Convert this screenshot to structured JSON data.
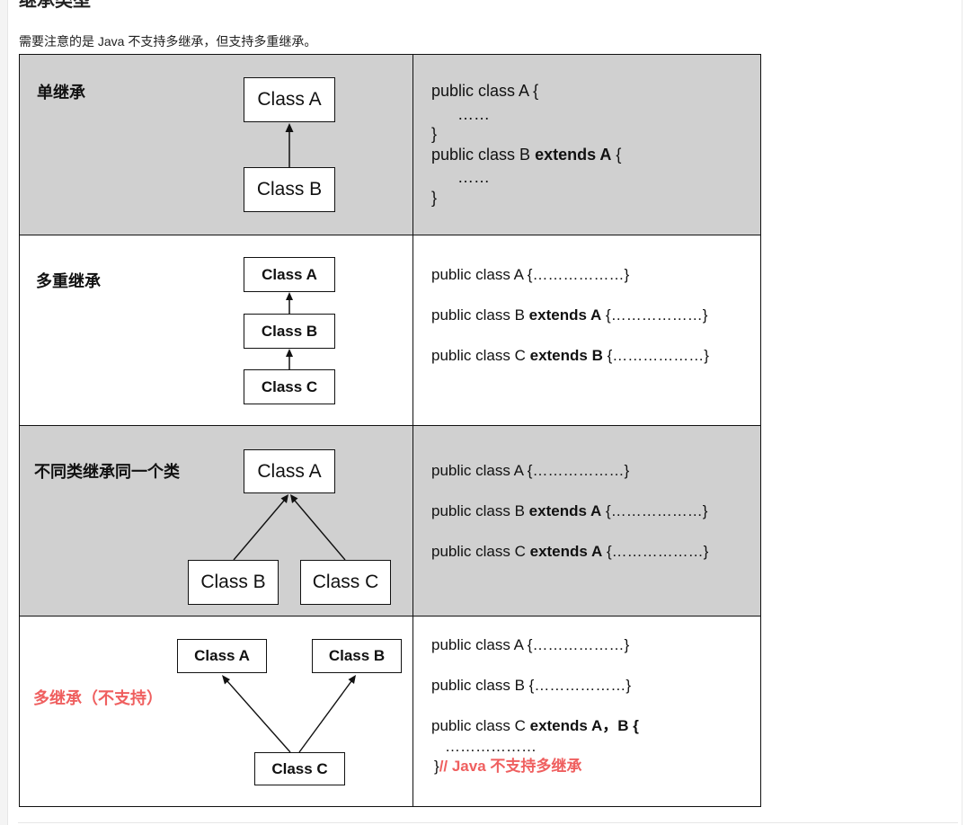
{
  "doc": {
    "heading": "继承类型",
    "intro": "需要注意的是 Java 不支持多继承，但支持多重继承。"
  },
  "rows": [
    {
      "label": "单继承",
      "boxes": [
        "Class A",
        "Class B"
      ],
      "code": {
        "line1": "public class A {",
        "dots1": "……",
        "close1": "}",
        "line2_pre": "public class B ",
        "line2_bold": "extends A",
        "line2_post": " {",
        "dots2": "……",
        "close2": "}"
      }
    },
    {
      "label": "多重继承",
      "boxes": [
        "Class A",
        "Class B",
        "Class C"
      ],
      "code": {
        "line1": "public class A {………………}",
        "line2_pre": "public class B ",
        "line2_bold": "extends A",
        "line2_post": " {………………}",
        "line3_pre": "public class C ",
        "line3_bold": "extends B",
        "line3_post": " {………………}"
      }
    },
    {
      "label": "不同类继承同一个类",
      "boxes": [
        "Class A",
        "Class B",
        "Class C"
      ],
      "code": {
        "line1": "public class A {………………}",
        "line2_pre": "public class B ",
        "line2_bold": "extends A",
        "line2_post": " {………………}",
        "line3_pre": "public class C ",
        "line3_bold": "extends A",
        "line3_post": " {………………}"
      }
    },
    {
      "label": "多继承（不支持）",
      "boxes": [
        "Class A",
        "Class B",
        "Class C"
      ],
      "code": {
        "line1": "public class A {………………}",
        "line2": "public class B {………………}",
        "line3_pre": "public class C ",
        "line3_bold": "extends A，B {",
        "dots": "………………",
        "close": "}",
        "comment": "// Java 不支持多继承"
      }
    }
  ],
  "colors": {
    "gray_row": "#d0d0d0",
    "accent_red": "#ef5f5f"
  }
}
